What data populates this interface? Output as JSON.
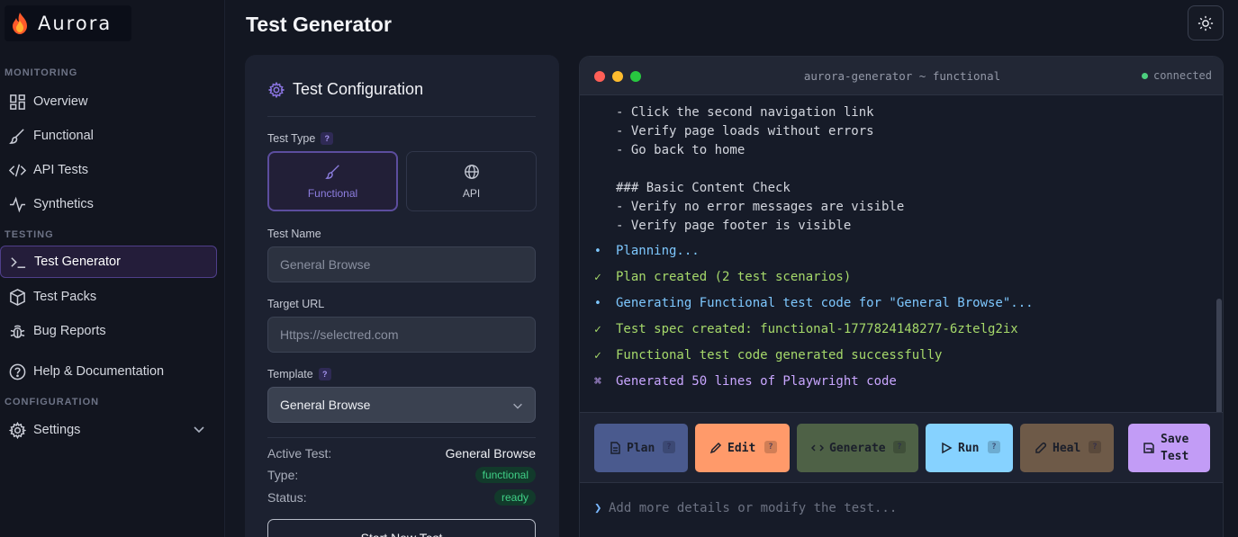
{
  "app": {
    "name": "Aurora"
  },
  "sidebar": {
    "sections": [
      {
        "label": "MONITORING"
      },
      {
        "label": "TESTING"
      },
      {
        "label": "CONFIGURATION"
      }
    ],
    "items": [
      {
        "label": "Overview",
        "icon": "grid-icon"
      },
      {
        "label": "Functional",
        "icon": "brush-icon"
      },
      {
        "label": "API Tests",
        "icon": "code-icon"
      },
      {
        "label": "Synthetics",
        "icon": "activity-icon"
      },
      {
        "label": "Test Generator",
        "icon": "terminal-icon",
        "active": true
      },
      {
        "label": "Test Packs",
        "icon": "package-icon"
      },
      {
        "label": "Bug Reports",
        "icon": "bug-icon"
      },
      {
        "label": "Help & Documentation",
        "icon": "help-circle-icon"
      },
      {
        "label": "Settings",
        "icon": "gear-icon"
      }
    ]
  },
  "header": {
    "title": "Test Generator",
    "theme_icon": "sun-icon"
  },
  "config": {
    "title": "Test Configuration",
    "test_type_label": "Test Type",
    "types": [
      {
        "label": "Functional",
        "selected": true
      },
      {
        "label": "API",
        "selected": false
      }
    ],
    "test_name_label": "Test Name",
    "test_name_value": "General Browse",
    "target_url_label": "Target URL",
    "target_url_value": "Https://selectred.com",
    "template_label": "Template",
    "template_value": "General Browse",
    "active_test_label": "Active Test:",
    "active_test_value": "General Browse",
    "type_label": "Type:",
    "type_value": "functional",
    "status_label": "Status:",
    "status_value": "ready",
    "start_button": "Start New Test",
    "help_mark": "?"
  },
  "terminal": {
    "title": "aurora-generator ~ functional",
    "connection": "connected",
    "lines": [
      "- Click the second navigation link",
      "- Verify page loads without errors",
      "- Go back to home",
      "",
      "### Basic Content Check",
      "- Verify no error messages are visible",
      "- Verify page footer is visible"
    ],
    "log": [
      {
        "mark": "•",
        "text": "Planning...",
        "color": "#7ec8ff"
      },
      {
        "mark": "✓",
        "text": "Plan created (2 test scenarios)",
        "color": "#a6d96a"
      },
      {
        "mark": "•",
        "text": "Generating Functional test code for \"General Browse\"...",
        "color": "#7ec8ff"
      },
      {
        "mark": "✓",
        "text": "Test spec created: functional-1777824148277-6ztelg2ix",
        "color": "#a6d96a"
      },
      {
        "mark": "✓",
        "text": "Functional test code generated successfully",
        "color": "#a6d96a"
      },
      {
        "mark": "⌘",
        "text": "Generated 50 lines of Playwright code",
        "color": "#c9a6ff"
      }
    ],
    "actions": [
      {
        "label": "Plan",
        "icon": "file-icon",
        "bg": "#4a5a8e"
      },
      {
        "label": "Edit",
        "icon": "pencil-icon",
        "bg": "#ff9a6a"
      },
      {
        "label": "Generate",
        "icon": "code-icon",
        "bg": "#4e6146"
      },
      {
        "label": "Run",
        "icon": "play-icon",
        "bg": "#86d2ff"
      },
      {
        "label": "Heal",
        "icon": "wrench-icon",
        "bg": "#6e5a48"
      },
      {
        "label": "Save\nTest",
        "icon": "save-icon",
        "bg": "#c29cf6"
      }
    ],
    "input_placeholder": "Add more details or modify the test...",
    "prompt": "❯"
  }
}
